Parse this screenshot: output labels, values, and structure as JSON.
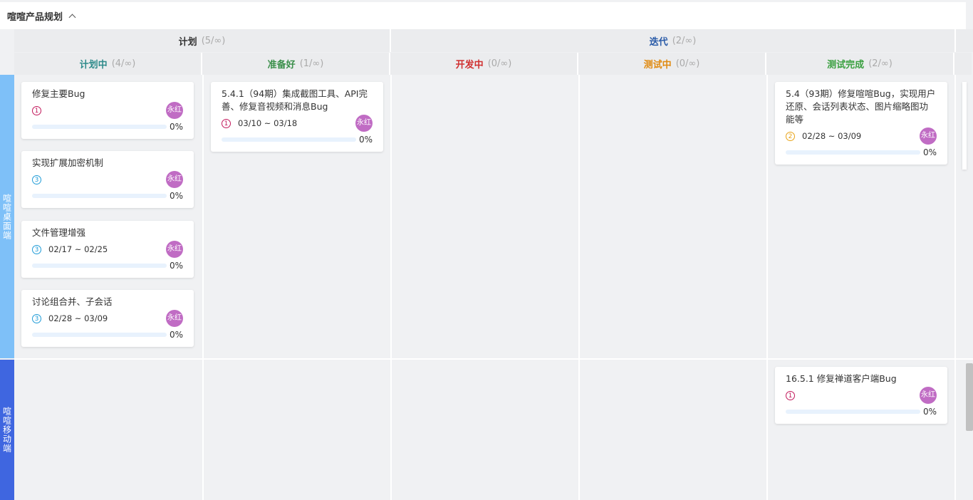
{
  "board": {
    "title": "喧喧产品规划"
  },
  "groups": [
    {
      "label": "计划",
      "count": "(5/∞)",
      "color": "#333333"
    },
    {
      "label": "迭代",
      "count": "(2/∞)",
      "color": "#2a5ba8"
    }
  ],
  "columns": [
    {
      "label": "计划中",
      "count": "(4/∞)",
      "color": "#2e8b8b"
    },
    {
      "label": "准备好",
      "count": "(1/∞)",
      "color": "#3a8f4a"
    },
    {
      "label": "开发中",
      "count": "(0/∞)",
      "color": "#d03030"
    },
    {
      "label": "测试中",
      "count": "(0/∞)",
      "color": "#e08a10"
    },
    {
      "label": "测试完成",
      "count": "(2/∞)",
      "color": "#3aa040"
    }
  ],
  "lanes": [
    {
      "label": "喧喧桌面端",
      "color": "#7ec0f8"
    },
    {
      "label": "喧喧移动端",
      "color": "#3f66e0"
    }
  ],
  "cards": [
    {
      "title": "修复主要Bug",
      "priority": "1",
      "date": "",
      "assignee": "永红",
      "progress": "0%"
    },
    {
      "title": "实现扩展加密机制",
      "priority": "3",
      "date": "",
      "assignee": "永红",
      "progress": "0%"
    },
    {
      "title": "文件管理增强",
      "priority": "3",
      "date": "02/17 ~ 02/25",
      "assignee": "永红",
      "progress": "0%"
    },
    {
      "title": "讨论组合并、子会话",
      "priority": "3",
      "date": "02/28 ~ 03/09",
      "assignee": "永红",
      "progress": "0%"
    },
    {
      "title": "5.4.1（94期）集成截图工具、API完善、修复音视频和消息Bug",
      "priority": "1",
      "date": "03/10 ~ 03/18",
      "assignee": "永红",
      "progress": "0%"
    },
    {
      "title": "5.4（93期）修复喧喧Bug，实现用户还原、会话列表状态、图片缩略图功能等",
      "priority": "2",
      "date": "02/28 ~ 03/09",
      "assignee": "永红",
      "progress": "0%"
    },
    {
      "title": "16.5.1 修复禅道客户端Bug",
      "priority": "1",
      "date": "",
      "assignee": "永红",
      "progress": "0%"
    }
  ],
  "priority_colors": {
    "1": "#c2185b",
    "2": "#e8a317",
    "3": "#1e9bd7"
  }
}
